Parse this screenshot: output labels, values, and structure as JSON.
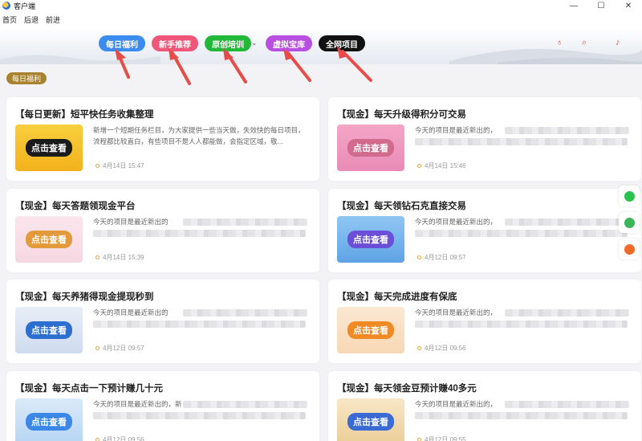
{
  "app": {
    "title": "客户端"
  },
  "window_controls": {
    "minimize": "—",
    "maximize": "☐",
    "close": "✕"
  },
  "menu": [
    "首页",
    "后退",
    "前进"
  ],
  "nav": [
    {
      "label": "每日福利",
      "color": "#3b8cf0"
    },
    {
      "label": "新手推荐",
      "color": "#f0567a"
    },
    {
      "label": "原创培训",
      "color": "#22b83a"
    },
    {
      "label": "虚拟宝库",
      "color": "#b94fe0"
    },
    {
      "label": "全网项目",
      "color": "#111111"
    }
  ],
  "header_icons": [
    "award-icon",
    "search-icon",
    "bell-icon"
  ],
  "section_badge": "每日福利",
  "cards": [
    {
      "title": "【每日更新】短平快任务收集整理",
      "thumb_text": "点击查看",
      "thumb_style": "yellow",
      "desc": "新增一个短期任务栏目，为大家提供一些当天做，失效快的每日项目，流程都比较直白，有些项目不是人人都能做，会指定区域，敬...",
      "date": "4月14日 15:47",
      "blurred": false
    },
    {
      "title": "【现金】每天升级得积分可交易",
      "thumb_text": "点击查看",
      "thumb_style": "pinkplay",
      "desc": "今天的项目是最近新出的，",
      "date": "4月14日 15:46",
      "blurred": true
    },
    {
      "title": "【现金】每天答题领现金平台",
      "thumb_text": "点击查看",
      "thumb_style": "dog",
      "desc": "今天的项目是最近新出的",
      "date": "4月14日 15:39",
      "blurred": true
    },
    {
      "title": "【现金】每天领钻石克直接交易",
      "thumb_text": "点击查看",
      "thumb_style": "bluecursor",
      "desc": "今天的项目是最近新出的，",
      "date": "4月12日 09:57",
      "blurred": true
    },
    {
      "title": "【现金】每天养猪得现金提现秒到",
      "thumb_text": "点击查看",
      "thumb_style": "sparkle",
      "desc": "今天的项目是最近新出的",
      "date": "4月12日 09:57",
      "blurred": true
    },
    {
      "title": "【现金】每天完成进度有保底",
      "thumb_text": "点击查看",
      "thumb_style": "orangehand",
      "desc": "今天的项目是最近新出的，",
      "date": "4月12日 09:56",
      "blurred": true
    },
    {
      "title": "【现金】每天点击一下预计赚几十元",
      "thumb_text": "点击查看",
      "thumb_style": "bluebtn",
      "desc": "今天的项目是最近新出的，新",
      "date": "4月12日 09:56",
      "blurred": true
    },
    {
      "title": "【现金】每天领金豆预计赚40多元",
      "thumb_text": "点击查看",
      "thumb_style": "board",
      "desc": "今天的项目是最近新出的，",
      "date": "4月12日 09:55",
      "blurred": true
    }
  ],
  "side_buttons": [
    {
      "name": "wechat-icon",
      "color": "#2bc14d"
    },
    {
      "name": "share-icon",
      "color": "#3cb55a"
    },
    {
      "name": "weibo-icon",
      "color": "#f06a2a"
    }
  ]
}
